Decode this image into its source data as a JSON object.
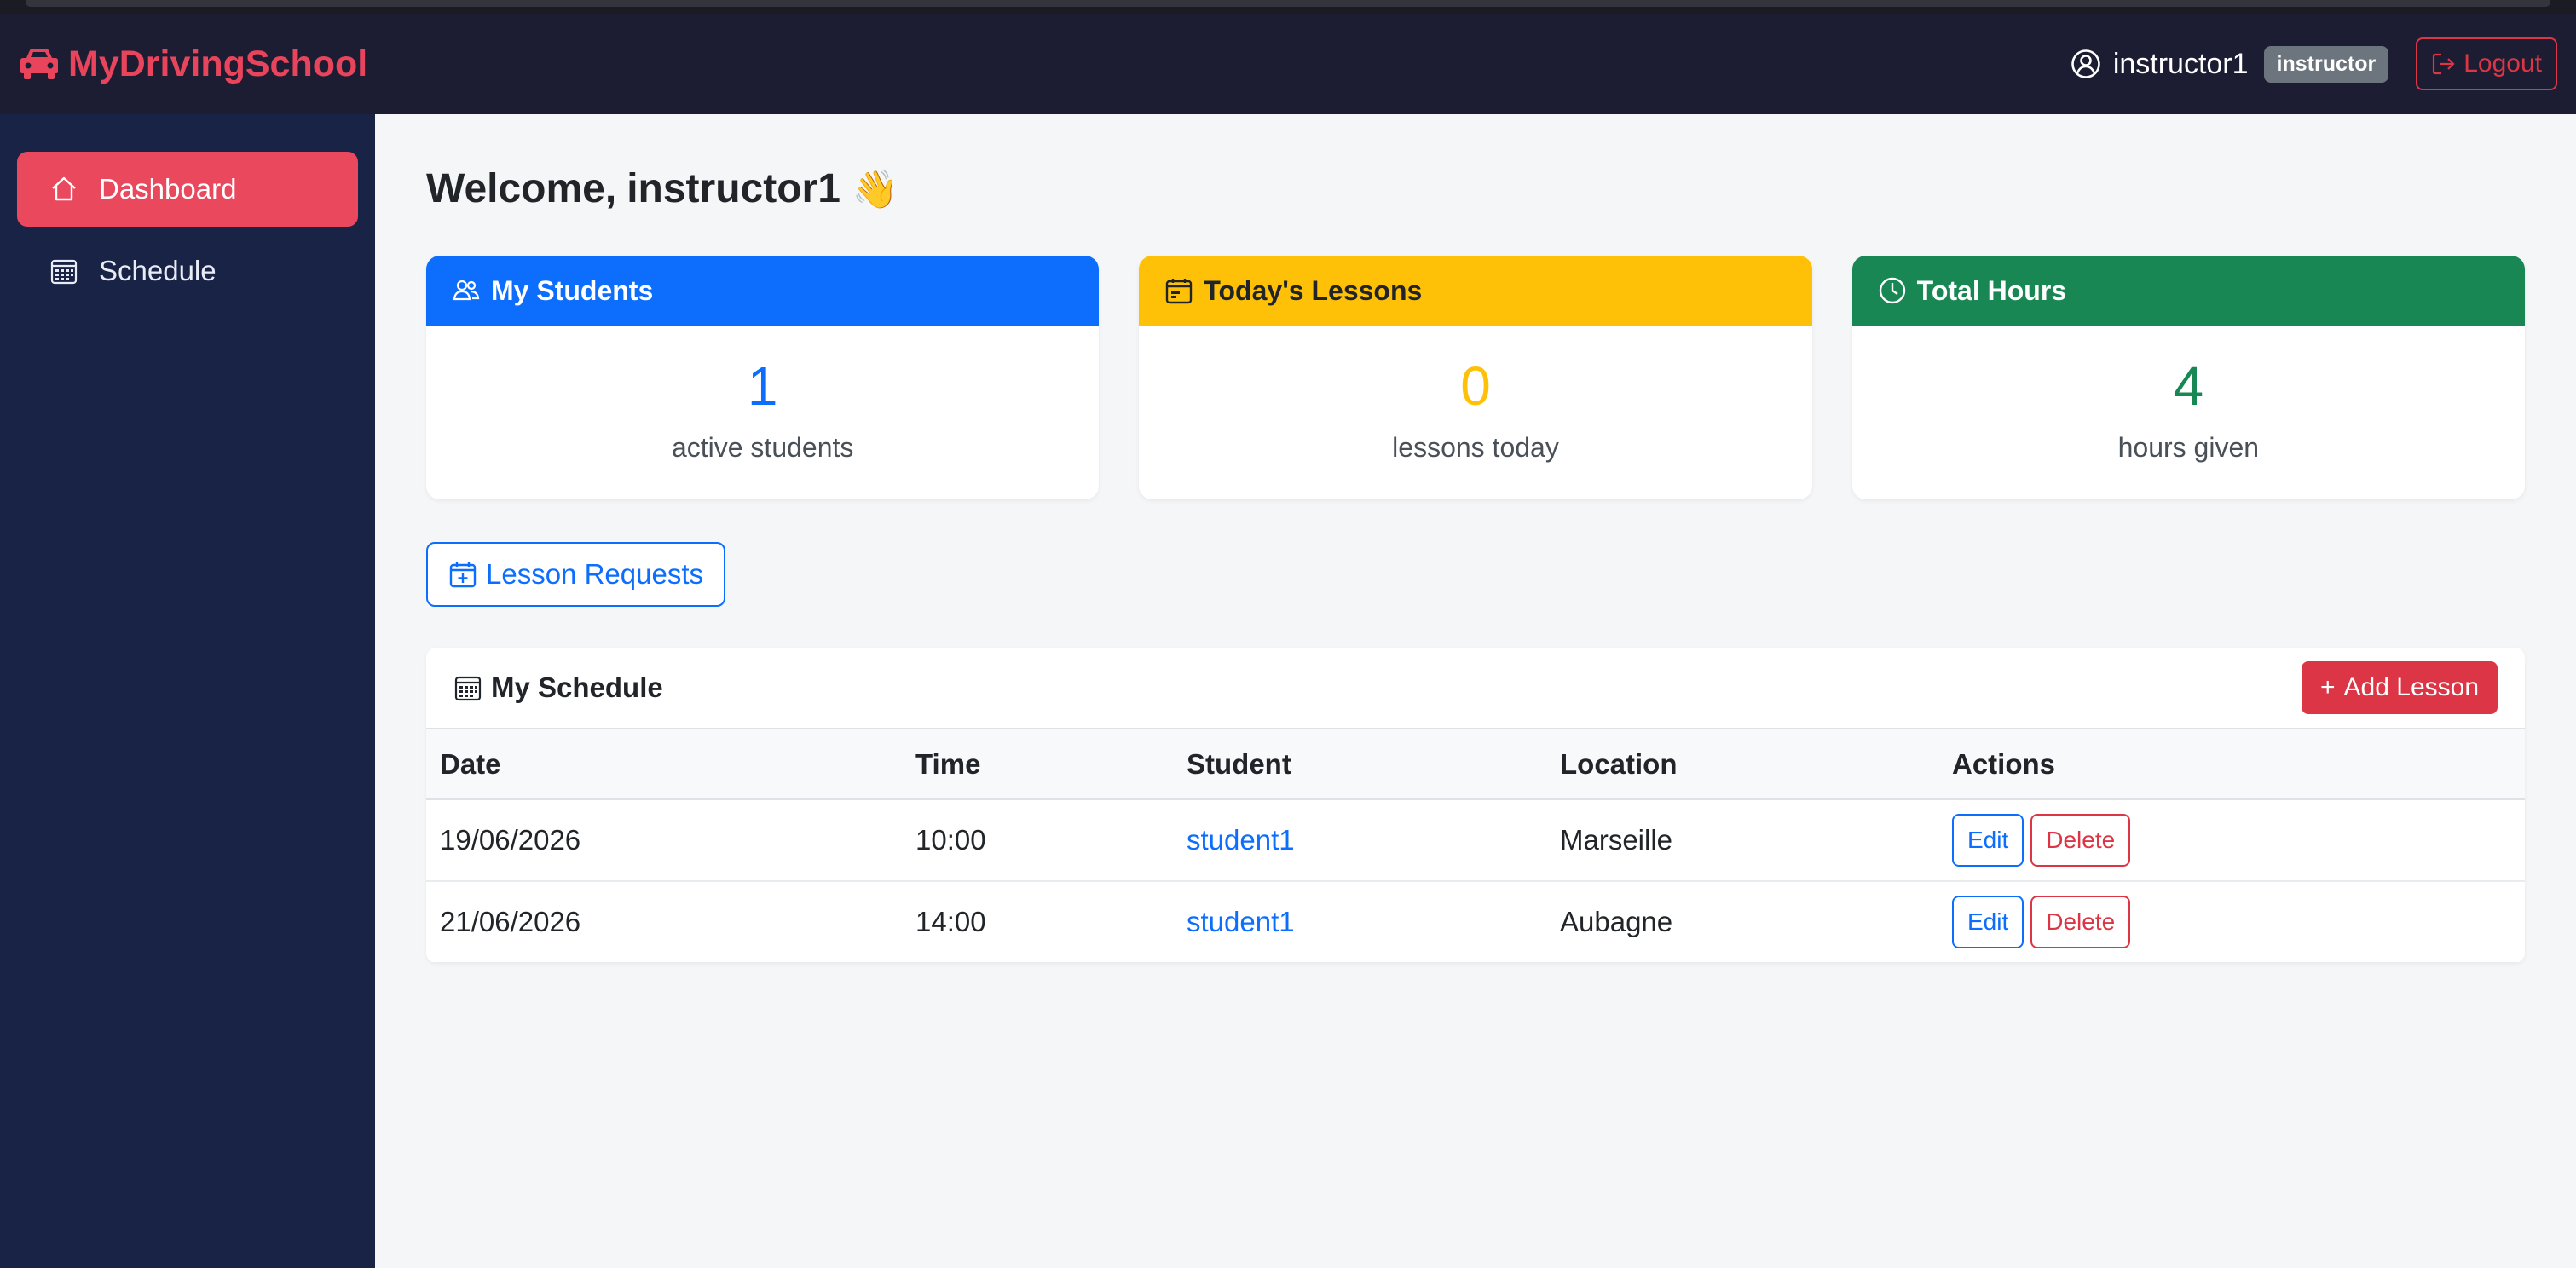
{
  "app": {
    "brand": "MyDrivingSchool",
    "brand_color": "#e8455c"
  },
  "header": {
    "username": "instructor1",
    "role_badge": "instructor",
    "logout_label": "Logout"
  },
  "sidebar": {
    "items": [
      {
        "label": "Dashboard",
        "icon": "house-icon",
        "active": true
      },
      {
        "label": "Schedule",
        "icon": "calendar-grid-icon",
        "active": false
      }
    ]
  },
  "welcome": {
    "prefix": "Welcome,",
    "name": "instructor1",
    "emoji": "👋"
  },
  "cards": [
    {
      "title": "My Students",
      "icon": "people-icon",
      "value": "1",
      "label": "active students",
      "color": "#0d6efd"
    },
    {
      "title": "Today's Lessons",
      "icon": "calendar-icon",
      "value": "0",
      "label": "lessons today",
      "color": "#ffc107"
    },
    {
      "title": "Total Hours",
      "icon": "clock-icon",
      "value": "4",
      "label": "hours given",
      "color": "#198754"
    }
  ],
  "lesson_requests_label": "Lesson Requests",
  "schedule": {
    "title": "My Schedule",
    "add_label": "Add Lesson",
    "columns": [
      "Date",
      "Time",
      "Student",
      "Location",
      "Actions"
    ],
    "rows": [
      {
        "date": "19/06/2026",
        "time": "10:00",
        "student": "student1",
        "location": "Marseille"
      },
      {
        "date": "21/06/2026",
        "time": "14:00",
        "student": "student1",
        "location": "Aubagne"
      }
    ],
    "edit_label": "Edit",
    "delete_label": "Delete"
  }
}
